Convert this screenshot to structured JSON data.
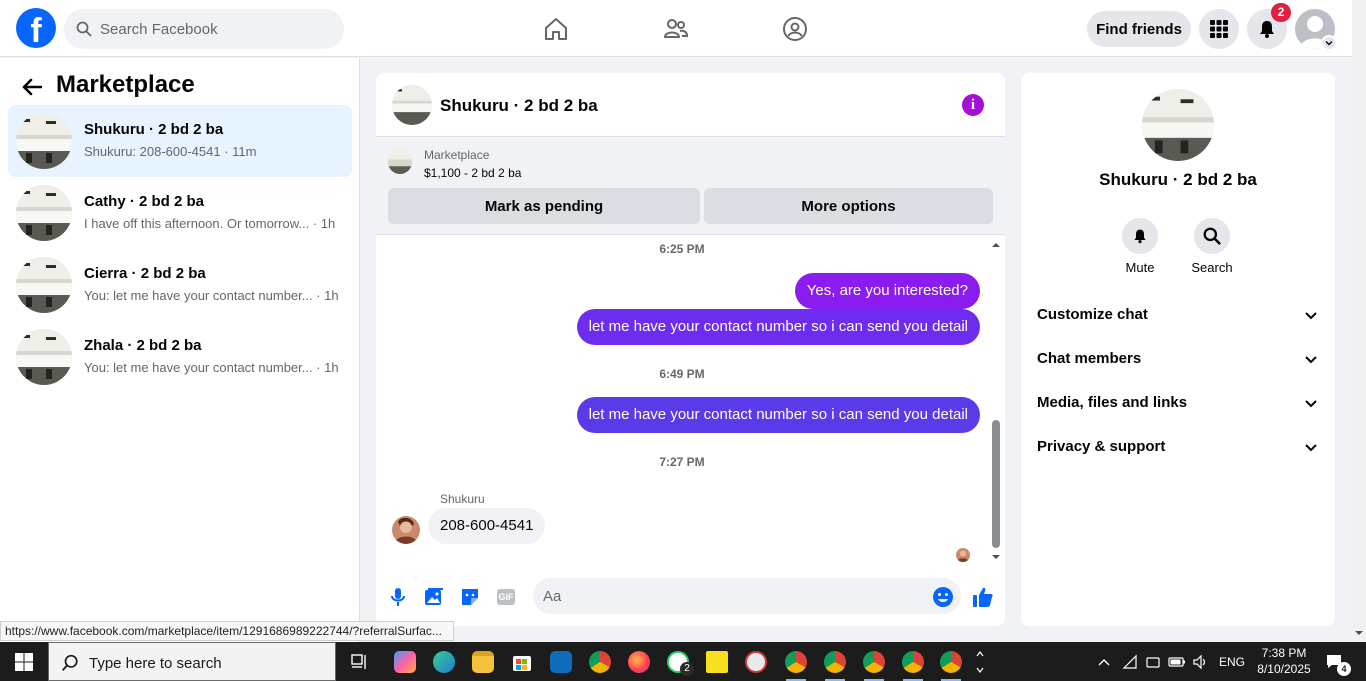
{
  "topbar": {
    "search_placeholder": "Search Facebook",
    "find_friends": "Find friends",
    "notification_count": "2"
  },
  "left": {
    "title": "Marketplace",
    "conversations": [
      {
        "name": "Shukuru · 2 bd 2 ba",
        "preview": "Shukuru: 208-600-4541 · 11m"
      },
      {
        "name": "Cathy · 2 bd 2 ba",
        "preview": "I have off this afternoon. Or tomorrow... · 1h"
      },
      {
        "name": "Cierra · 2 bd 2 ba",
        "preview": "You: let me have your contact number... · 1h"
      },
      {
        "name": "Zhala · 2 bd 2 ba",
        "preview": "You: let me have your contact number... · 1h"
      }
    ]
  },
  "chat": {
    "title": "Shukuru · 2 bd 2 ba",
    "listing_category": "Marketplace",
    "listing_price": "$1,100 - 2 bd 2 ba",
    "mark_pending": "Mark as pending",
    "more_options": "More options",
    "messages": [
      {
        "time": "6:25 PM"
      },
      {
        "out1": "Yes, are you interested?"
      },
      {
        "out2": "let me have your contact number so i can send you detail"
      },
      {
        "time": "6:49 PM"
      },
      {
        "out3": "let me have your contact number so i can send you detail"
      },
      {
        "time": "7:27 PM"
      },
      {
        "sender": "Shukuru",
        "in": "208-600-4541"
      }
    ],
    "composer_placeholder": "Aa",
    "gif_label": "GIF"
  },
  "right": {
    "title": "Shukuru · 2 bd 2 ba",
    "mute": "Mute",
    "search": "Search",
    "rows": [
      "Customize chat",
      "Chat members",
      "Media, files and links",
      "Privacy & support"
    ]
  },
  "status_url": "https://www.facebook.com/marketplace/item/1291686989222744/?referralSurfac...",
  "taskbar": {
    "search_text": "Type here to search",
    "whatsapp_badge": "2",
    "lang": "ENG",
    "time": "7:38 PM",
    "date": "8/10/2025",
    "notif_count": "4"
  },
  "colors": {
    "fb_blue": "#0866ff",
    "messenger_purple": "#8a1cf0",
    "notification_red": "#e41e3f",
    "active_conversation": "#e7f3ff"
  }
}
